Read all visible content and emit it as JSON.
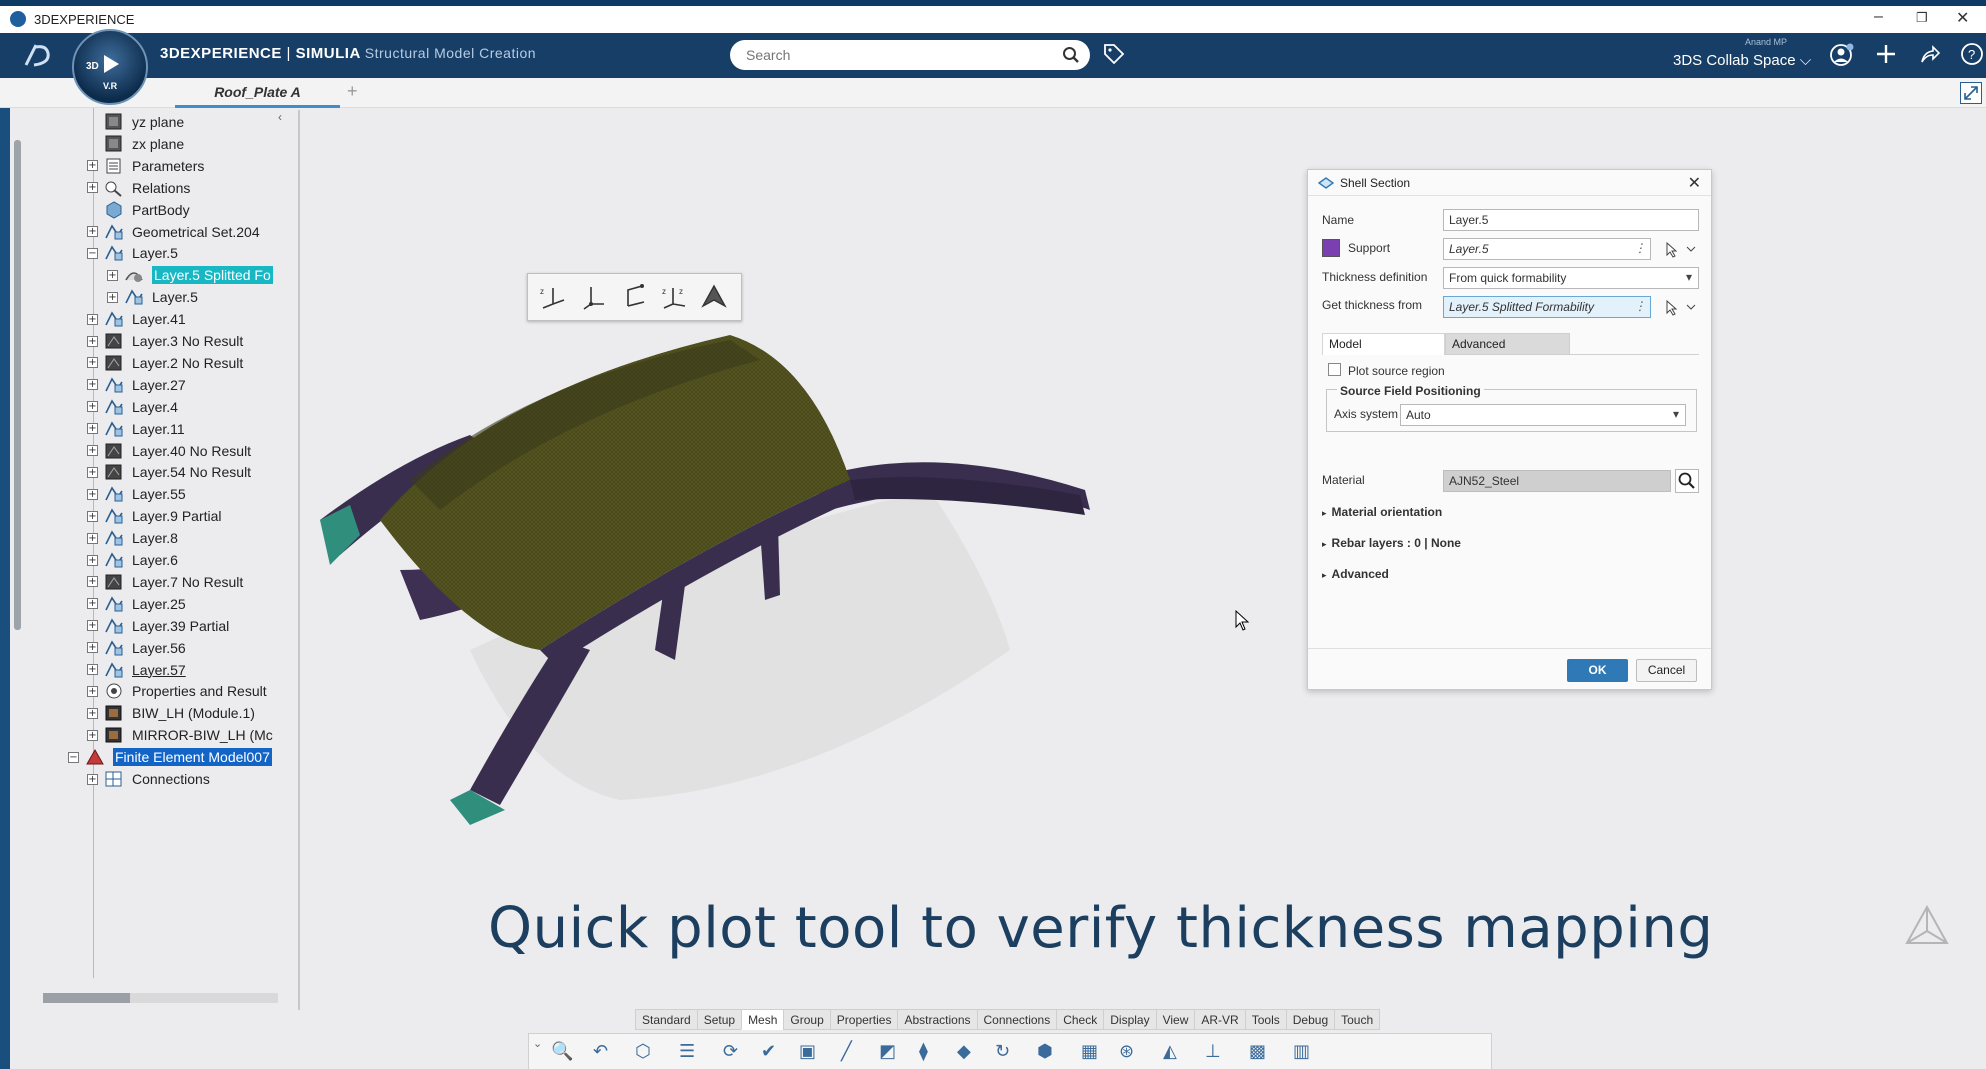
{
  "window": {
    "title": "3DEXPERIENCE",
    "controls": [
      "–",
      "❐",
      "✕"
    ]
  },
  "header": {
    "brand_bold": "3DEXPERIENCE",
    "brand_sep": " | ",
    "brand_app": "SIMULIA",
    "app_name": "Structural Model Creation",
    "compass_label": "3D",
    "compass_version": "V.R",
    "search_placeholder": "Search",
    "user_name": "Anand MP",
    "collab_space": "3DS Collab Space ⌵"
  },
  "tabs": {
    "active": "Roof_Plate A",
    "add": "+"
  },
  "tree": {
    "collapse": "‹",
    "items": [
      {
        "label": "yz plane",
        "icon": "plane-icon",
        "indent": 0,
        "exp": ""
      },
      {
        "label": "zx plane",
        "icon": "plane-icon",
        "indent": 0,
        "exp": ""
      },
      {
        "label": "Parameters",
        "icon": "parameters-icon",
        "indent": 0,
        "exp": "+"
      },
      {
        "label": "Relations",
        "icon": "relations-icon",
        "indent": 0,
        "exp": "+"
      },
      {
        "label": "PartBody",
        "icon": "partbody-icon",
        "indent": 0,
        "exp": ""
      },
      {
        "label": "Geometrical Set.204",
        "icon": "geoset-icon",
        "indent": 0,
        "exp": "+"
      },
      {
        "label": "Layer.5",
        "icon": "layer-icon",
        "indent": 0,
        "exp": "−"
      },
      {
        "label": "Layer.5 Splitted Fo",
        "icon": "formability-icon",
        "indent": 1,
        "exp": "+",
        "style": "sel-cyan"
      },
      {
        "label": "Layer.5",
        "icon": "layer-icon",
        "indent": 1,
        "exp": "+"
      },
      {
        "label": "Layer.41",
        "icon": "layer-icon",
        "indent": 0,
        "exp": "+"
      },
      {
        "label": "Layer.3 No Result",
        "icon": "noresult-icon",
        "indent": 0,
        "exp": "+"
      },
      {
        "label": "Layer.2 No Result",
        "icon": "noresult-icon",
        "indent": 0,
        "exp": "+"
      },
      {
        "label": "Layer.27",
        "icon": "layer-icon",
        "indent": 0,
        "exp": "+"
      },
      {
        "label": "Layer.4",
        "icon": "layer-icon",
        "indent": 0,
        "exp": "+"
      },
      {
        "label": "Layer.11",
        "icon": "layer-icon",
        "indent": 0,
        "exp": "+"
      },
      {
        "label": "Layer.40 No Result",
        "icon": "noresult-icon",
        "indent": 0,
        "exp": "+"
      },
      {
        "label": "Layer.54 No Result",
        "icon": "noresult-icon",
        "indent": 0,
        "exp": "+"
      },
      {
        "label": "Layer.55",
        "icon": "layer-icon",
        "indent": 0,
        "exp": "+"
      },
      {
        "label": "Layer.9 Partial",
        "icon": "layer-icon",
        "indent": 0,
        "exp": "+"
      },
      {
        "label": "Layer.8",
        "icon": "layer-icon",
        "indent": 0,
        "exp": "+"
      },
      {
        "label": "Layer.6",
        "icon": "layer-icon",
        "indent": 0,
        "exp": "+"
      },
      {
        "label": "Layer.7 No Result",
        "icon": "noresult-icon",
        "indent": 0,
        "exp": "+"
      },
      {
        "label": "Layer.25",
        "icon": "layer-icon",
        "indent": 0,
        "exp": "+"
      },
      {
        "label": "Layer.39 Partial",
        "icon": "layer-icon",
        "indent": 0,
        "exp": "+"
      },
      {
        "label": "Layer.56",
        "icon": "layer-icon",
        "indent": 0,
        "exp": "+"
      },
      {
        "label": "Layer.57",
        "icon": "layer-icon",
        "indent": 0,
        "exp": "+",
        "style": "ul"
      },
      {
        "label": "Properties and Result",
        "icon": "properties-icon",
        "indent": 0,
        "exp": "+"
      },
      {
        "label": "BIW_LH (Module.1)",
        "icon": "module-icon",
        "indent": 0,
        "exp": "+"
      },
      {
        "label": "MIRROR-BIW_LH (Mc",
        "icon": "module-icon",
        "indent": 0,
        "exp": "+"
      },
      {
        "label": "Finite Element Model007",
        "icon": "fem-icon",
        "indent": -1,
        "exp": "−",
        "style": "sel-blue"
      },
      {
        "label": "Connections",
        "icon": "connections-icon",
        "indent": 0,
        "exp": "+"
      }
    ]
  },
  "dialog": {
    "title": "Shell Section",
    "name_label": "Name",
    "name_value": "Layer.5",
    "support_label": "Support",
    "support_value": "Layer.5",
    "thickness_def_label": "Thickness definition",
    "thickness_def_value": "From quick formability",
    "thickness_from_label": "Get thickness from",
    "thickness_from_value": "Layer.5 Splitted Formability",
    "tab_model": "Model",
    "tab_advanced": "Advanced",
    "plot_source_label": "Plot source region",
    "source_field_title": "Source Field Positioning",
    "axis_label": "Axis system",
    "axis_value": "Auto",
    "material_label": "Material",
    "material_value": "AJN52_Steel",
    "sect_material_orientation": "Material orientation",
    "sect_rebar": "Rebar layers : 0 | None",
    "sect_advanced": "Advanced",
    "ok": "OK",
    "cancel": "Cancel"
  },
  "caption": "Quick plot tool to verify thickness mapping",
  "bottom_tabs": [
    "Standard",
    "Setup",
    "Mesh",
    "Group",
    "Properties",
    "Abstractions",
    "Connections",
    "Check",
    "Display",
    "View",
    "AR-VR",
    "Tools",
    "Debug",
    "Touch"
  ],
  "bottom_tools": [
    "zoom-area-icon",
    "undo-icon",
    "part-icon",
    "list-icon",
    "update-icon",
    "check-icon",
    "solid-icon",
    "line-icon",
    "surface-mesh-icon",
    "mesh-icon",
    "tetra-icon",
    "transform-icon",
    "assembly-icon",
    "cube-icon",
    "sphere-icon",
    "plane-cut-icon",
    "axis-icon",
    "grid-icon",
    "box-mesh-icon"
  ],
  "colors": {
    "topbar": "#173e66",
    "accent": "#2e79b6",
    "selection_cyan": "#17b7c4",
    "selection_blue": "#1264c7",
    "caption": "#1c3f60",
    "support_swatch": "#7a3fb0"
  }
}
